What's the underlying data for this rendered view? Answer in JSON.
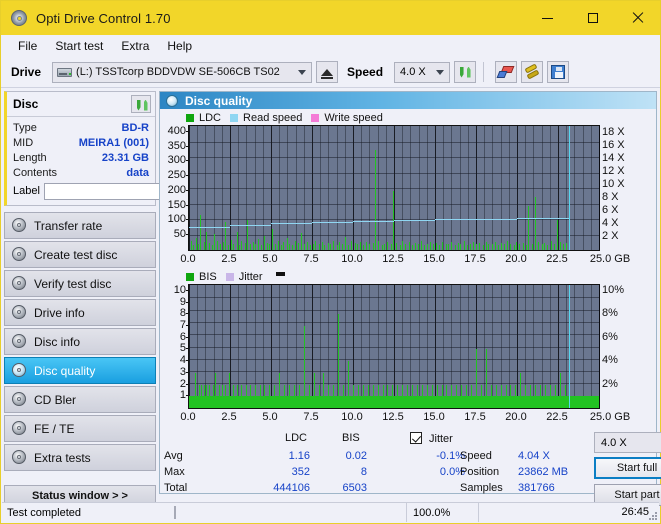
{
  "window": {
    "title": "Opti Drive Control 1.70",
    "icon": "disc-icon",
    "controls": {
      "minimize": "–",
      "maximize": "□",
      "close": "✕"
    },
    "titlebar_color": "#f2d629"
  },
  "menubar": {
    "items": [
      "File",
      "Start test",
      "Extra",
      "Help"
    ]
  },
  "toolbar": {
    "drive_label": "Drive",
    "drive_value": "(L:)   TSSTcorp BDDVDW SE-506CB TS02",
    "eject_icon": "eject-icon",
    "speed_label": "Speed",
    "speed_value": "4.0 X",
    "refresh_icon": "refresh-icon",
    "erase_icon": "eraser-icon",
    "tools_icon": "tools-icon",
    "save_icon": "save-icon"
  },
  "sidebar": {
    "disc_panel": {
      "title": "Disc",
      "refresh_icon": "refresh-icon",
      "rows": [
        {
          "key": "Type",
          "value": "BD-R"
        },
        {
          "key": "MID",
          "value": "MEIRA1 (001)"
        },
        {
          "key": "Length",
          "value": "23.31 GB"
        },
        {
          "key": "Contents",
          "value": "data"
        }
      ],
      "label_key": "Label",
      "label_value": "",
      "label_placeholder": "",
      "label_icon": "cd-icon"
    },
    "nav_items": [
      {
        "label": "Transfer rate",
        "active": false
      },
      {
        "label": "Create test disc",
        "active": false
      },
      {
        "label": "Verify test disc",
        "active": false
      },
      {
        "label": "Drive info",
        "active": false
      },
      {
        "label": "Disc info",
        "active": false
      },
      {
        "label": "Disc quality",
        "active": true
      },
      {
        "label": "CD Bler",
        "active": false
      },
      {
        "label": "FE / TE",
        "active": false
      },
      {
        "label": "Extra tests",
        "active": false
      }
    ],
    "status_window_button": "Status window > >"
  },
  "main": {
    "header_title": "Disc quality",
    "header_icon": "disc-icon"
  },
  "chart_data": [
    {
      "type": "bar",
      "title": "Disc quality",
      "id": "ldc-chart",
      "legend": [
        {
          "label": "LDC",
          "color": "#0fa60f"
        },
        {
          "label": "Read speed",
          "color": "#8fd6f2"
        },
        {
          "label": "Write speed",
          "color": "#f47bd6"
        }
      ],
      "legend_position": "top-left",
      "grid": true,
      "xlabel": "GB",
      "ylabel": "LDC",
      "xlim": [
        0,
        25
      ],
      "ylim": [
        0,
        420
      ],
      "xticks": [
        "0.0",
        "2.5",
        "5.0",
        "7.5",
        "10.0",
        "12.5",
        "15.0",
        "17.5",
        "20.0",
        "22.5",
        "25.0 GB"
      ],
      "yticks": [
        "400",
        "350",
        "300",
        "250",
        "200",
        "150",
        "100",
        "50"
      ],
      "y2label": "Speed",
      "y2lim": [
        0,
        19
      ],
      "y2ticks": [
        "18 X",
        "16 X",
        "14 X",
        "12 X",
        "10 X",
        "8 X",
        "6 X",
        "4 X",
        "2 X"
      ],
      "series": [
        {
          "name": "LDC",
          "color": "#22c322",
          "x": [
            0.1,
            0.25,
            0.4,
            0.55,
            0.7,
            0.9,
            1.05,
            1.2,
            1.4,
            1.55,
            1.7,
            1.9,
            2.05,
            2.2,
            2.35,
            2.55,
            2.7,
            2.9,
            3.05,
            3.2,
            3.4,
            3.55,
            3.7,
            3.9,
            4.05,
            4.2,
            4.4,
            4.6,
            4.75,
            4.9,
            5.05,
            5.25,
            5.4,
            5.6,
            5.75,
            5.95,
            6.1,
            6.3,
            6.45,
            6.65,
            6.8,
            7.0,
            7.2,
            7.35,
            7.55,
            7.7,
            7.9,
            8.1,
            8.25,
            8.45,
            8.6,
            8.8,
            9.0,
            9.15,
            9.35,
            9.5,
            9.7,
            9.9,
            10.1,
            10.25,
            10.45,
            10.6,
            10.8,
            11.0,
            11.2,
            11.35,
            11.55,
            11.75,
            11.9,
            12.1,
            12.3,
            12.45,
            12.65,
            12.85,
            13.0,
            13.2,
            13.4,
            13.6,
            13.75,
            13.95,
            14.15,
            14.3,
            14.5,
            14.7,
            14.9,
            15.05,
            15.25,
            15.45,
            15.65,
            15.8,
            16.0,
            16.2,
            16.4,
            16.55,
            16.75,
            16.95,
            17.15,
            17.3,
            17.5,
            17.7,
            17.9,
            18.1,
            18.25,
            18.45,
            18.65,
            18.85,
            19.0,
            19.2,
            19.4,
            19.6,
            19.8,
            19.95,
            20.15,
            20.35,
            20.55,
            20.7,
            20.9,
            21.1,
            21.3,
            21.5,
            21.65,
            21.85,
            22.05,
            22.25,
            22.45,
            22.6,
            22.8,
            23.0
          ],
          "values": [
            32,
            18,
            40,
            22,
            120,
            28,
            60,
            24,
            18,
            55,
            30,
            20,
            26,
            95,
            18,
            35,
            22,
            60,
            18,
            30,
            24,
            100,
            20,
            28,
            22,
            36,
            18,
            48,
            24,
            20,
            70,
            22,
            30,
            18,
            26,
            40,
            22,
            18,
            30,
            24,
            58,
            20,
            26,
            18,
            22,
            30,
            20,
            28,
            18,
            24,
            20,
            32,
            18,
            26,
            22,
            44,
            18,
            30,
            24,
            20,
            28,
            18,
            26,
            20,
            24,
            340,
            30,
            18,
            22,
            26,
            20,
            200,
            24,
            18,
            30,
            22,
            26,
            18,
            24,
            20,
            30,
            18,
            22,
            26,
            20,
            24,
            18,
            28,
            20,
            22,
            26,
            18,
            24,
            20,
            30,
            18,
            22,
            26,
            20,
            24,
            18,
            28,
            22,
            20,
            26,
            18,
            24,
            20,
            30,
            22,
            18,
            26,
            20,
            24,
            18,
            150,
            22,
            180,
            26,
            20,
            24,
            18,
            30,
            22,
            100,
            26,
            20,
            24
          ]
        },
        {
          "name": "Read speed",
          "color": "#8fd6f2",
          "x": [
            0.0,
            2.5,
            5.0,
            7.5,
            10.0,
            12.5,
            15.0,
            17.5,
            20.0,
            22.5,
            23.2
          ],
          "values": [
            3.3,
            3.6,
            3.9,
            4.1,
            4.3,
            4.5,
            4.6,
            4.7,
            4.8,
            4.85,
            4.85
          ]
        }
      ],
      "cursor_position_gb": 23.2
    },
    {
      "type": "bar",
      "id": "bis-chart",
      "legend": [
        {
          "label": "BIS",
          "color": "#0fa60f"
        },
        {
          "label": "Jitter",
          "color": "#c9b6e8"
        }
      ],
      "legend_position": "top-left",
      "grid": true,
      "xlabel": "GB",
      "ylabel": "BIS",
      "xlim": [
        0,
        25
      ],
      "ylim": [
        0,
        10.5
      ],
      "xticks": [
        "0.0",
        "2.5",
        "5.0",
        "7.5",
        "10.0",
        "12.5",
        "15.0",
        "17.5",
        "20.0",
        "22.5",
        "25.0 GB"
      ],
      "yticks": [
        "10",
        "9",
        "8",
        "7",
        "6",
        "5",
        "4",
        "3",
        "2",
        "1"
      ],
      "y2label": "Jitter",
      "y2lim": [
        0,
        10.5
      ],
      "y2ticks": [
        "10%",
        "8%",
        "6%",
        "4%",
        "2%"
      ],
      "series": [
        {
          "name": "BIS",
          "color": "#22c322",
          "baseline": 1,
          "x": [
            0.35,
            0.6,
            0.75,
            0.9,
            1.05,
            1.2,
            1.45,
            1.6,
            1.8,
            2.0,
            2.2,
            2.45,
            2.7,
            2.95,
            3.2,
            3.45,
            3.7,
            4.0,
            4.3,
            4.6,
            4.9,
            5.2,
            5.5,
            5.8,
            6.1,
            6.4,
            6.7,
            7.0,
            7.3,
            7.6,
            7.9,
            8.2,
            8.5,
            8.8,
            9.1,
            9.4,
            9.7,
            10.0,
            10.3,
            10.6,
            10.9,
            11.2,
            11.5,
            11.8,
            12.1,
            12.4,
            12.7,
            13.0,
            13.3,
            13.6,
            13.9,
            14.2,
            14.5,
            14.8,
            15.1,
            15.4,
            15.7,
            16.0,
            16.3,
            16.6,
            16.9,
            17.2,
            17.5,
            17.8,
            18.1,
            18.4,
            18.7,
            19.0,
            19.3,
            19.6,
            19.9,
            20.2,
            20.5,
            20.8,
            21.1,
            21.4,
            21.7,
            22.0,
            22.3,
            22.6,
            22.9
          ],
          "values": [
            3,
            2,
            2,
            2,
            2,
            2,
            2,
            3,
            2,
            2,
            2,
            3,
            2,
            2,
            2,
            2,
            2,
            2,
            2,
            2,
            2,
            2,
            3,
            2,
            2,
            2,
            2,
            7,
            2,
            3,
            2,
            3,
            2,
            2,
            8,
            2,
            4,
            2,
            2,
            2,
            2,
            2,
            2,
            2,
            2,
            2,
            2,
            2,
            2,
            2,
            2,
            2,
            2,
            2,
            2,
            2,
            2,
            2,
            2,
            2,
            2,
            2,
            5,
            2,
            5,
            2,
            2,
            2,
            2,
            2,
            2,
            3,
            2,
            2,
            2,
            2,
            2,
            2,
            2,
            3,
            2
          ]
        }
      ],
      "cursor_position_gb": 23.2
    }
  ],
  "stats": {
    "columns": [
      "LDC",
      "BIS"
    ],
    "jitter_label": "Jitter",
    "jitter_checked": true,
    "rows": [
      {
        "name": "Avg",
        "ldc": "1.16",
        "bis": "0.02",
        "jitter": "-0.1%"
      },
      {
        "name": "Max",
        "ldc": "352",
        "bis": "8",
        "jitter": "0.0%"
      },
      {
        "name": "Total",
        "ldc": "444106",
        "bis": "6503",
        "jitter": ""
      }
    ],
    "right": [
      {
        "key": "Speed",
        "value": "4.04 X"
      },
      {
        "key": "Position",
        "value": "23862 MB"
      },
      {
        "key": "Samples",
        "value": "381766"
      }
    ],
    "speed_select": "4.0 X",
    "start_full_button": "Start full",
    "start_part_button": "Start part"
  },
  "statusbar": {
    "message": "Test completed",
    "progress_percent": 100.0,
    "progress_text": "100.0%",
    "elapsed_time": "26:45"
  }
}
